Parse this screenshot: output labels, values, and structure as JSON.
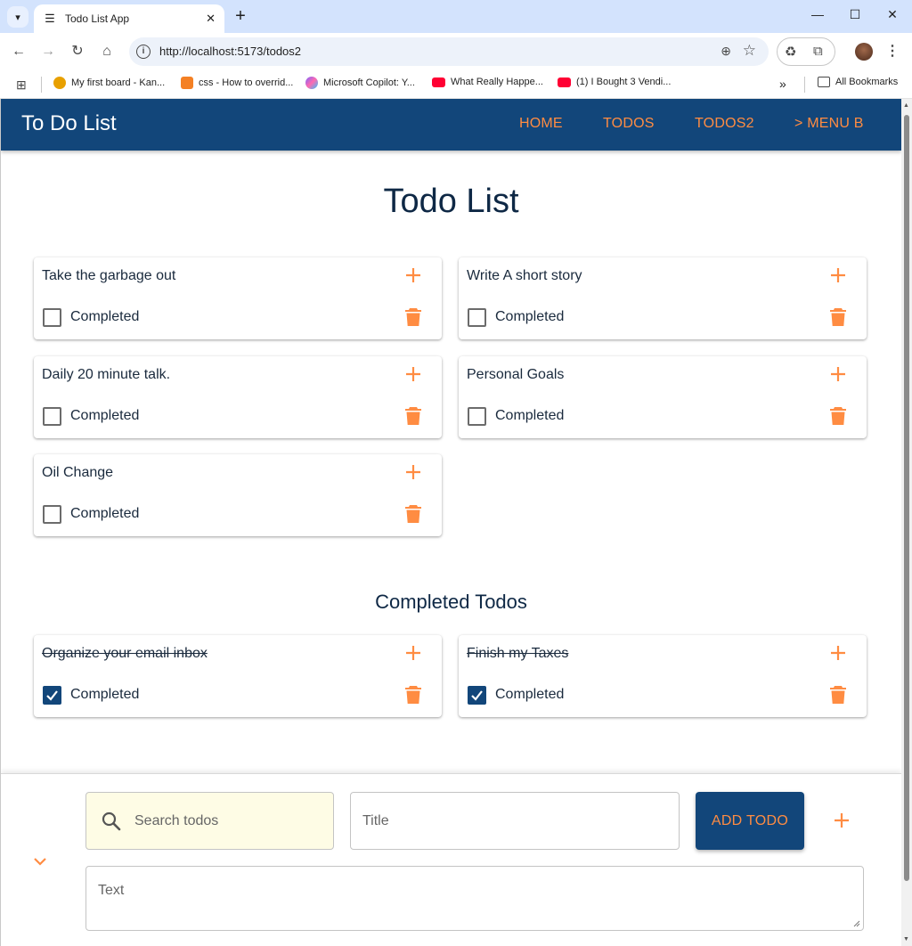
{
  "browser": {
    "tab_title": "Todo List App",
    "url": "http://localhost:5173/todos2",
    "bookmarks": [
      {
        "label": "My first board - Kan...",
        "color": "#e8a000"
      },
      {
        "label": "css - How to overrid...",
        "color": "#f48024"
      },
      {
        "label": "Microsoft Copilot: Y...",
        "color": "#7b61ff"
      },
      {
        "label": "What Really Happe...",
        "color": "#ff0033"
      },
      {
        "label": "(1) I Bought 3 Vendi...",
        "color": "#ff0033"
      }
    ],
    "all_bookmarks": "All Bookmarks"
  },
  "appbar": {
    "brand": "To Do List",
    "links": [
      "HOME",
      "TODOS",
      "TODOS2",
      "> MENU B"
    ]
  },
  "main": {
    "title": "Todo List",
    "completed_title": "Completed Todos",
    "completed_label": "Completed",
    "todos": [
      {
        "title": "Take the garbage out",
        "done": false
      },
      {
        "title": "Write A short story",
        "done": false
      },
      {
        "title": "Daily 20 minute talk.",
        "done": false
      },
      {
        "title": "Personal Goals",
        "done": false
      },
      {
        "title": "Oil Change",
        "done": false
      }
    ],
    "completed": [
      {
        "title": "Organize your email inbox",
        "done": true
      },
      {
        "title": "Finish my Taxes",
        "done": true
      }
    ]
  },
  "form": {
    "search_placeholder": "Search todos",
    "title_placeholder": "Title",
    "add_label": "ADD TODO",
    "text_placeholder": "Text"
  },
  "colors": {
    "primary": "#12467a",
    "accent": "#ff8c42",
    "search_bg": "#fefce5"
  }
}
